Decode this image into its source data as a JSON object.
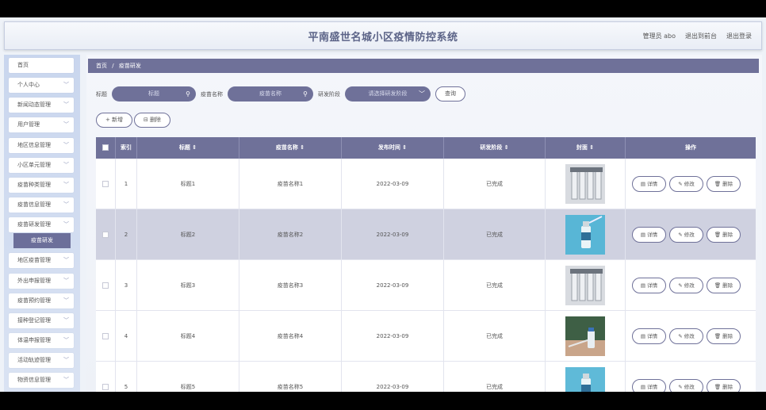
{
  "header": {
    "title": "平南盛世名城小区疫情防控系统",
    "admin": "管理员 abo",
    "back_to_admin": "退出到前台",
    "logout": "退出登录"
  },
  "sidebar": {
    "items": [
      {
        "label": "首页"
      },
      {
        "label": "个人中心"
      },
      {
        "label": "新闻动态管理"
      },
      {
        "label": "用户管理"
      },
      {
        "label": "地区信息管理"
      },
      {
        "label": "小区单元管理"
      },
      {
        "label": "疫苗种类管理"
      },
      {
        "label": "疫苗信息管理"
      },
      {
        "label": "疫苗研发管理"
      },
      {
        "label": "地区疫苗管理"
      },
      {
        "label": "外出申报管理"
      },
      {
        "label": "疫苗预约管理"
      },
      {
        "label": "接种登记管理"
      },
      {
        "label": "体温申报管理"
      },
      {
        "label": "活动轨迹管理"
      },
      {
        "label": "物资信息管理"
      }
    ],
    "active_sub": "疫苗研发"
  },
  "breadcrumb": {
    "home": "首页",
    "sep": "/",
    "current": "疫苗研发"
  },
  "filters": {
    "title_label": "标题",
    "title_placeholder": "标题",
    "name_label": "疫苗名称",
    "name_placeholder": "疫苗名称",
    "stage_label": "研发阶段",
    "stage_placeholder": "请选择研发阶段",
    "query": "查询"
  },
  "toolbar": {
    "add": "+ 新增",
    "delete": "⊟ 删除"
  },
  "table": {
    "columns": [
      "索引",
      "标题 ⇕",
      "疫苗名称 ⇕",
      "发布时间 ⇕",
      "研发阶段 ⇕",
      "封面 ⇕",
      "操作"
    ],
    "rows": [
      {
        "index": "1",
        "title": "标题1",
        "name": "疫苗名称1",
        "date": "2022-03-09",
        "stage": "已完成"
      },
      {
        "index": "2",
        "title": "标题2",
        "name": "疫苗名称2",
        "date": "2022-03-09",
        "stage": "已完成"
      },
      {
        "index": "3",
        "title": "标题3",
        "name": "疫苗名称3",
        "date": "2022-03-09",
        "stage": "已完成"
      },
      {
        "index": "4",
        "title": "标题4",
        "name": "疫苗名称4",
        "date": "2022-03-09",
        "stage": "已完成"
      },
      {
        "index": "5",
        "title": "标题5",
        "name": "疫苗名称5",
        "date": "2022-03-09",
        "stage": "已完成"
      }
    ],
    "actions": {
      "detail": "详情",
      "edit": "修改",
      "delete": "删除"
    }
  }
}
